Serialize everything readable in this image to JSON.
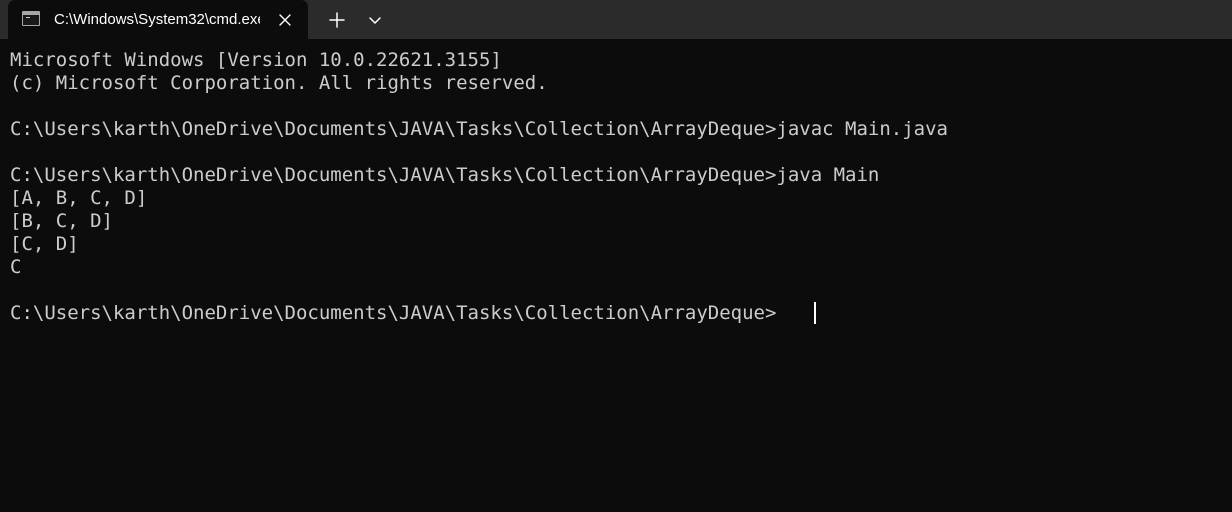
{
  "tab": {
    "title": "C:\\Windows\\System32\\cmd.exe"
  },
  "console": {
    "lines": [
      "Microsoft Windows [Version 10.0.22621.3155]",
      "(c) Microsoft Corporation. All rights reserved.",
      "",
      "C:\\Users\\karth\\OneDrive\\Documents\\JAVA\\Tasks\\Collection\\ArrayDeque>javac Main.java",
      "",
      "C:\\Users\\karth\\OneDrive\\Documents\\JAVA\\Tasks\\Collection\\ArrayDeque>java Main",
      "[A, B, C, D]",
      "[B, C, D]",
      "[C, D]",
      "C",
      "",
      "C:\\Users\\karth\\OneDrive\\Documents\\JAVA\\Tasks\\Collection\\ArrayDeque>"
    ]
  },
  "icons": {
    "tab_icon": "command-prompt-icon",
    "close": "close-icon",
    "new_tab": "plus-icon",
    "dropdown": "chevron-down-icon"
  },
  "colors": {
    "background": "#0c0c0c",
    "tabbar": "#2b2b2b",
    "text": "#cccccc"
  }
}
